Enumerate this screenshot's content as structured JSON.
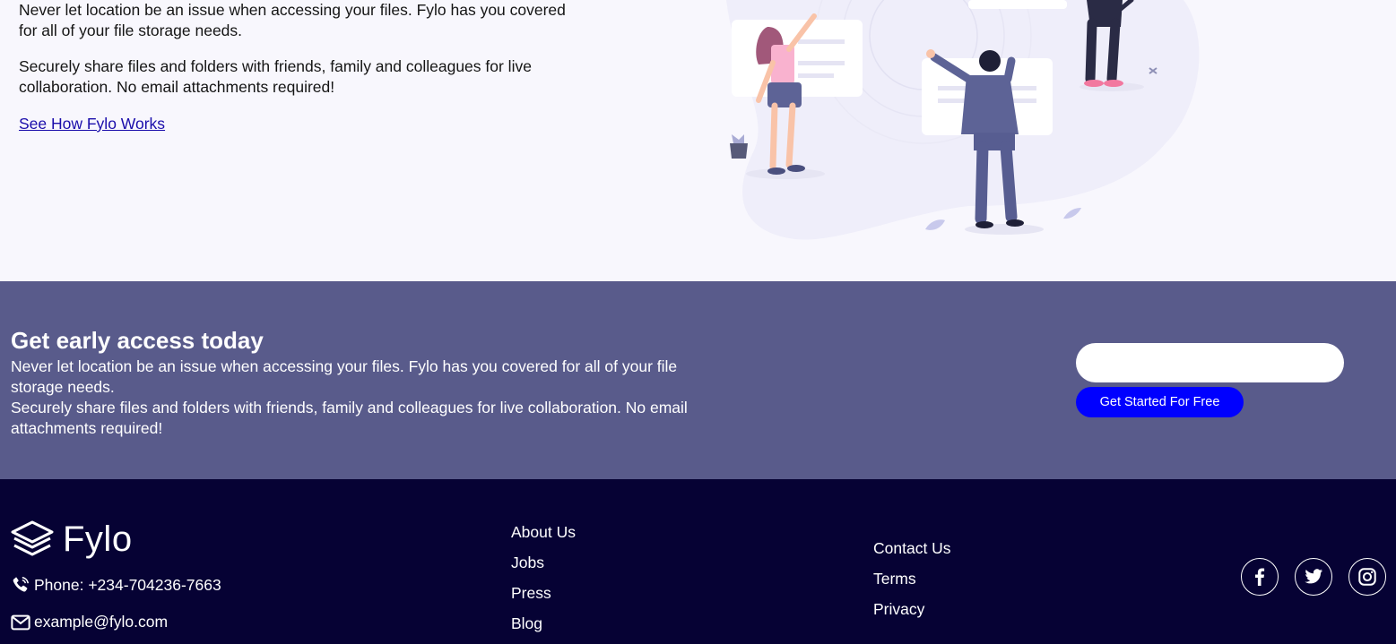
{
  "hero": {
    "paragraph1": "Never let location be an issue when accessing your files. Fylo has you covered for all of your file storage needs.",
    "paragraph2": "Securely share files and folders with friends, family and colleagues for live collaboration. No email attachments required!",
    "link_label": "See How Fylo Works"
  },
  "early_access": {
    "title": "Get early access today",
    "text1": "Never let location be an issue when accessing your files. Fylo has you covered for all of your file storage needs.",
    "text2": "Securely share files and folders with friends, family and colleagues for live collaboration. No email attachments required!",
    "email_value": "",
    "button_label": "Get Started For Free"
  },
  "footer": {
    "brand": "Fylo",
    "phone": "Phone: +234-704236-7663",
    "email": "example@fylo.com",
    "links_col1": [
      "About Us",
      "Jobs",
      "Press",
      "Blog"
    ],
    "links_col2": [
      "Contact Us",
      "Terms",
      "Privacy"
    ],
    "socials": [
      "facebook-icon",
      "twitter-icon",
      "instagram-icon"
    ]
  },
  "colors": {
    "page_bg": "#f8f7fd",
    "early_bg": "#595b8b",
    "footer_bg": "#060234",
    "cta": "#0000ff",
    "link": "#1a0dab"
  }
}
